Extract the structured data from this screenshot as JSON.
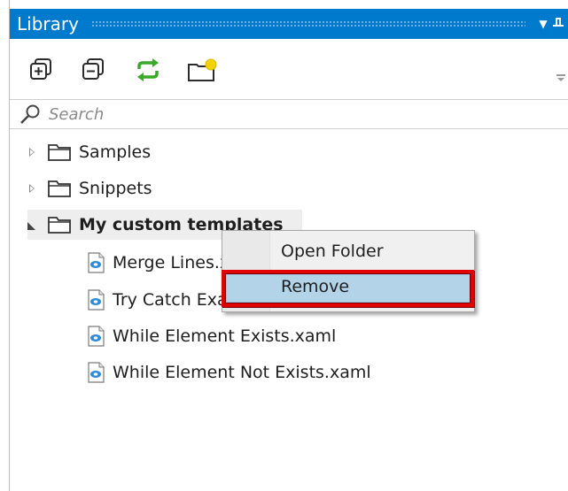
{
  "panel": {
    "title": "Library"
  },
  "toolbar": {
    "buttons": [
      {
        "name": "expand-all",
        "icon": "expand-all-icon"
      },
      {
        "name": "collapse-all",
        "icon": "collapse-all-icon"
      },
      {
        "name": "refresh",
        "icon": "refresh-icon"
      },
      {
        "name": "add-folder",
        "icon": "new-folder-icon"
      }
    ]
  },
  "search": {
    "placeholder": "Search"
  },
  "tree": {
    "nodes": [
      {
        "label": "Samples",
        "expanded": false
      },
      {
        "label": "Snippets",
        "expanded": false
      },
      {
        "label": "My custom templates",
        "expanded": true,
        "children": [
          {
            "label": "Merge Lines.xaml"
          },
          {
            "label": "Try Catch Example.xaml"
          },
          {
            "label": "While Element Exists.xaml"
          },
          {
            "label": "While Element Not Exists.xaml"
          }
        ]
      }
    ]
  },
  "context_menu": {
    "items": [
      {
        "label": "Open Folder"
      },
      {
        "label": "Remove"
      }
    ],
    "highlighted": "Remove"
  },
  "colors": {
    "title_bar": "#007acc",
    "refresh_icon": "#3aa82a",
    "new_folder_badge": "#f2d200",
    "menu_hover": "#b3d4e8",
    "annotation_box": "#e00000"
  }
}
